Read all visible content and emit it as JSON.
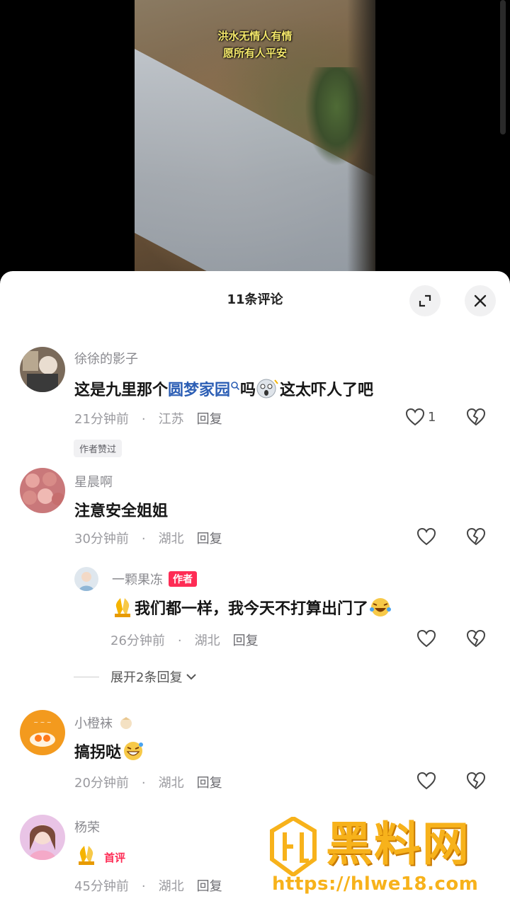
{
  "video": {
    "caption_line1": "洪水无情人有情",
    "caption_line2": "愿所有人平安"
  },
  "sheet": {
    "title": "11条评论"
  },
  "comments": [
    {
      "username": "徐徐的影子",
      "text_before": "这是九里那个",
      "link_text": "圆梦家园",
      "text_mid": "吗",
      "text_after": "这太吓人了吧",
      "time": "21分钟前",
      "location": "江苏",
      "reply_label": "回复",
      "like_count": "1",
      "tag": "作者赞过"
    },
    {
      "username": "星晨啊",
      "text": "注意安全姐姐",
      "time": "30分钟前",
      "location": "湖北",
      "reply_label": "回复"
    },
    {
      "username": "小橙袜",
      "text": "搞拐哒",
      "time": "20分钟前",
      "location": "湖北",
      "reply_label": "回复"
    },
    {
      "username": "杨荣",
      "badge": "首评",
      "time": "45分钟前",
      "location": "湖北",
      "reply_label": "回复"
    }
  ],
  "reply": {
    "username": "一颗果冻",
    "badge": "作者",
    "text": "我们都一样，我今天不打算出门了",
    "time": "26分钟前",
    "location": "湖北",
    "reply_label": "回复"
  },
  "expand_replies_label": "展开2条回复",
  "meta_separator": "·",
  "watermark": {
    "title": "黑料网",
    "url": "https://hlwe18.com"
  },
  "colors": {
    "accent": "#fe2c55",
    "link": "#2d5fb5",
    "watermark": "#f7b21b"
  }
}
